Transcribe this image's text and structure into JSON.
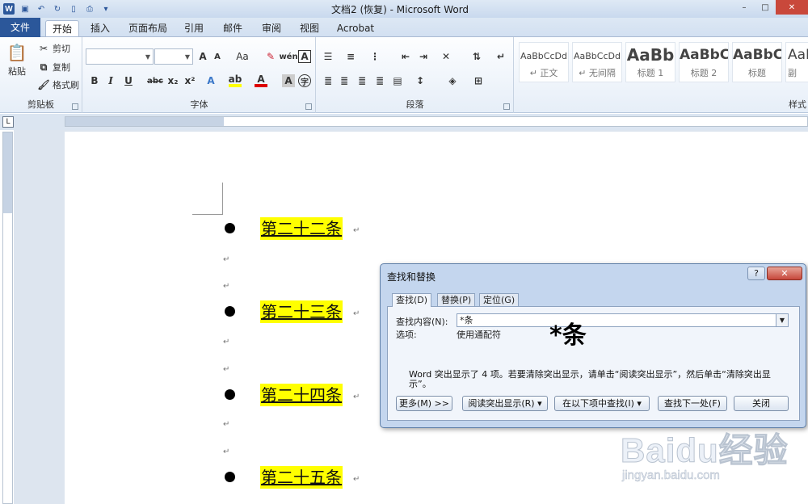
{
  "window": {
    "title": "文档2 (恢复) - Microsoft Word",
    "logo_letter": "W",
    "buttons": [
      "–",
      "□",
      "✕"
    ]
  },
  "tabs": [
    "文件",
    "开始",
    "插入",
    "页面布局",
    "引用",
    "邮件",
    "审阅",
    "视图",
    "Acrobat"
  ],
  "ribbon": {
    "clipboard": {
      "paste": "粘贴",
      "cut": "剪切",
      "copy": "复制",
      "format_painter": "格式刷",
      "label": "剪贴板"
    },
    "font": {
      "label": "字体",
      "bold": "B",
      "italic": "I",
      "underline": "U",
      "strike": "abc",
      "subscript": "x₂",
      "superscript": "x²",
      "grow": "A",
      "shrink": "A",
      "change_case": "Aa",
      "font_color": "A"
    },
    "paragraph": {
      "label": "段落"
    },
    "styles": {
      "label": "样式",
      "items": [
        {
          "sample": "AaBbCcDd",
          "name": "↵ 正文"
        },
        {
          "sample": "AaBbCcDd",
          "name": "↵ 无间隔"
        },
        {
          "sample": "AaBb",
          "name": "标题 1"
        },
        {
          "sample": "AaBbC",
          "name": "标题 2"
        },
        {
          "sample": "AaBbC",
          "name": "标题"
        },
        {
          "sample": "AaB",
          "name": "副"
        }
      ]
    }
  },
  "document": {
    "articles": [
      "第二十二条",
      "第二十三条",
      "第二十四条",
      "第二十五条"
    ],
    "para_mark": "↵"
  },
  "dialog": {
    "title": "查找和替换",
    "help": "?",
    "close": "✕",
    "tabs": [
      "查找(D)",
      "替换(P)",
      "定位(G)"
    ],
    "find_label": "查找内容(N):",
    "find_value": "*条",
    "options_label": "选项:",
    "options_value": "使用通配符",
    "overlay_text": "*条",
    "status": "Word 突出显示了 4 项。若要清除突出显示，请单击“阅读突出显示”，然后单击“清除突出显示”。",
    "buttons": {
      "more": "更多(M) >>",
      "reading_highlight": "阅读突出显示(R) ▾",
      "find_in": "在以下项中查找(I) ▾",
      "find_next": "查找下一处(F)",
      "close": "关闭"
    }
  },
  "watermark": {
    "text": "Baidu经验",
    "url": "jingyan.baidu.com"
  }
}
